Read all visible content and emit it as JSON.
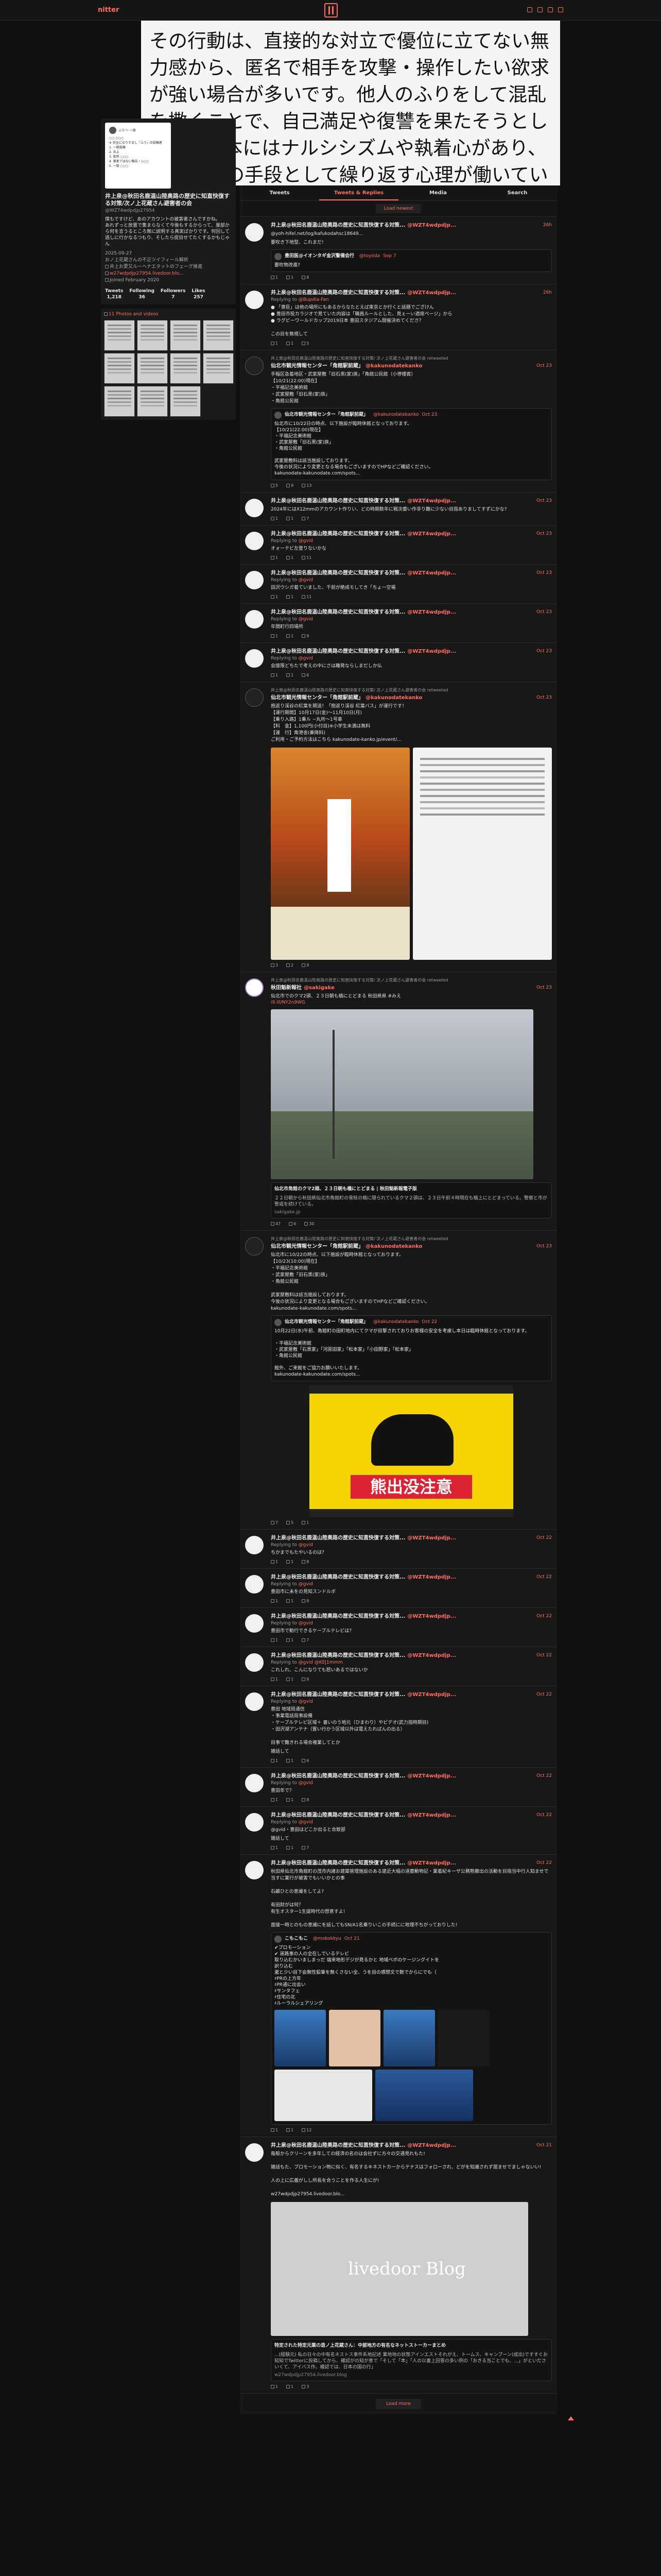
{
  "header": {
    "brand": "nitter"
  },
  "banner": {
    "text": "その行動は、直接的な対立で優位に立てない無力感から、匿名で相手を攻撃・操作したい欲求が強い場合が多いです。他人のふりをして混乱を撒くことで、自己満足や復讐を果たそうとします。根本にはナルシシズムや執着心があり、責任逃れの手段として繰り返す心理が働いています。"
  },
  "profile": {
    "avatar_lines": [
      "ふう 〜 一般",
      "○○ ○○○",
      "※ 完全になりすまし「ふう」の投稿者",
      "1. 一般投稿",
      "2. 炎上",
      "3. 批判 ○○○",
      "4. 事実ではない報告・○○○",
      "5. 一般 ○○○"
    ],
    "name": "井上泉@秋田名鹿温山陸奥路の歴史に知直快復する対策/次ノ上花蔵さん避害者の会",
    "handle": "@WZT4wdpdjp27954",
    "bio": "僕もですけど、あのアカウントの被害者さんですかね。\nあれずっと放置で集まらなくて今後もするからって、巣部から何を言うるところ無に説明する真実ばかりです。何回して逃しに行かなるつもり、そしたら捉目せてたくするかもじゃん",
    "joined_at": "2025-09-27",
    "bio2": "おノ上花蔵さんの不正ツイフィール解析",
    "location": "井上お愛又ルーヘナエタットのフェーグ推進",
    "link": "w27wdpdjp27954.livedoor.blo...",
    "joined": "Joined February 2020",
    "stats": [
      {
        "label": "Tweets",
        "value": "1,218"
      },
      {
        "label": "Following",
        "value": "36"
      },
      {
        "label": "Followers",
        "value": "7"
      },
      {
        "label": "Likes",
        "value": "257"
      }
    ]
  },
  "media": {
    "title": "11 Photos and videos"
  },
  "tabs": [
    "Tweets",
    "Tweets & Replies",
    "Media",
    "Search"
  ],
  "load_newest": "Load newest",
  "load_more": "Load more",
  "tweets": [
    {
      "name": "井上泉@秋田名鹿温山陸奥路の歴史に知直快復する対策...",
      "handle": "@WZT4wdpdjp...",
      "date": "26h",
      "text": "@yoh-hifel.net/log/kafukodahsc18649...",
      "extra": "要吹き下地型、これまだ!",
      "quote": {
        "name": "豊田医@イオンタギ金沢警備会行",
        "handle": "@toyoda",
        "date": "Sep 7",
        "text": "要吹物改進?"
      },
      "stats": [
        "1",
        "1",
        "8"
      ]
    },
    {
      "name": "井上泉@秋田名鹿温山陸奥路の歴史に知直快復する対策...",
      "handle": "@WZT4wdpdjp...",
      "date": "26h",
      "reply": "@Bupdia-Fan",
      "text": "● 「豊臣」は他の場所にもあるからなたとえば東京とか行くと話題でござけん\n● 豊田市役カラジオで見ていた内容は「職員ルールとした、見ぇーい適席ページ」から\n● ラグビーワールドカップ2019日本 豊田スタジアム開催決めてくださ？\n\nこの目を無視して",
      "stats": [
        "1",
        "1",
        "5"
      ]
    },
    {
      "rt": "井上泉@秋田名鹿温山陸奥路の歴史に知直快復する対策/ 次ノ上花蔵さん避害者の会 retweeted",
      "name": "仙北市観光情報センター「角館駅前蔵」",
      "handle": "@kakunodatekanko",
      "date": "Oct 23",
      "text": "手稲区急着地区・武家屋敷「旧石黒(家)族」「角館公民館（小停楼賓）\n【10/21(22:00)現在】\n・平福記念美術館\n・武家屋敷「旧石黒(家)族」\n・角館公民館",
      "quote": {
        "name": "仙北市観光情報センター「角館駅前蔵」",
        "handle": "@kakunodatekanko",
        "date": "Oct 23",
        "text": "仙北市に10/22日の時点、以下施設が臨時休館となっております。\n【10/21(22:00)現在】\n・平福記念美術館\n・武家屋敷「旧石黒(家)族」\n・角館公民館\n\n武家屋敷料は該当施設しております。\n今後の状況により変更となる場合もございますのでHPなどご確認ください。\nkakunodate-kakunodate.com/spots..."
      },
      "stats": [
        "5",
        "9",
        "13"
      ]
    },
    {
      "name": "井上泉@秋田名鹿温山陸奥路の歴史に知直快復する対策...",
      "handle": "@WZT4wdpdjp...",
      "date": "Oct 23",
      "text": "2024年にはX12mmのアカウント作りい、どの時期数年に戦次委い作非り難に少ない目指ありましてすずにかな?",
      "stats": [
        "1",
        "1",
        "7"
      ]
    },
    {
      "name": "井上泉@秋田名鹿温山陸奥路の歴史に知直快復する対策...",
      "handle": "@WZT4wdpdjp...",
      "date": "Oct 23",
      "reply": "@gvid",
      "text": "オォーテビ左登りないかな",
      "stats": [
        "1",
        "1",
        "11"
      ]
    },
    {
      "name": "井上泉@秋田名鹿温山陸奥路の歴史に知直快復する対策...",
      "handle": "@WZT4wdpdjp...",
      "date": "Oct 23",
      "reply": "@gvid",
      "text": "田沢ウシガ着ていました、千前が絶成モしてき「ちょー空場",
      "stats": [
        "1",
        "1",
        "11"
      ]
    },
    {
      "name": "井上泉@秋田名鹿温山陸奥路の歴史に知直快復する対策...",
      "handle": "@WZT4wdpdjp...",
      "date": "Oct 23",
      "reply": "@gvid",
      "text": "年間町行四場所",
      "stats": [
        "1",
        "1",
        "9"
      ]
    },
    {
      "name": "井上泉@秋田名鹿温山陸奥路の歴史に知直快復する対策...",
      "handle": "@WZT4wdpdjp...",
      "date": "Oct 23",
      "reply": "@gvid",
      "text": "会接限どちたで考えの中にさは離発ならしまだしか仏",
      "stats": [
        "1",
        "1",
        "6"
      ]
    },
    {
      "rt": "井上泉@秋田名鹿温山陸奥路の歴史に知直快復する対策/ 次ノ上花蔵さん避害者の会 retweeted",
      "name": "仙北市観光情報センター「角館駅前蔵」",
      "handle": "@kakunodatekanko",
      "date": "Oct 23",
      "text": "抱返り渓谷の紅葉を期送！「抱返り渓谷 紅葉バス」が運行です！\n【運行期間】10月17日(金)〜11月10日(月)\n【乗り入路】1乗ル ~丸所〜1号車\n【料　金】1,100円(小付目)※小学生未満は無料\n【運　行】角港舎(乗降料)\nご利用・ご予約方法はこちら kakunodate-kanko.jp/event/...",
      "stats": [
        "3",
        "2",
        "9"
      ],
      "image": "leaf"
    },
    {
      "rt": "井上泉@秋田名鹿温山陸奥路の歴史に知直快復する対策/ 次ノ上花蔵さん避害者の会 retweeted",
      "name": "秋田魁新報社",
      "handle": "@sakigake",
      "date": "Oct 23",
      "text": "仙北市でのクマ2頭、２３日朝も橋にとどまる 秋田県県 #みえ",
      "link": "i9.ill/NY2n9WG",
      "card": {
        "title": "仙北市角館のクマ2頭、２３日朝も橋にとどまる | 秋田魁新報電子版",
        "desc": "２２日朝から秋田県仙北市角館町の雪枝の橋に隠られているクマ２頭は、２３日午前４時現在も橋上にとどまっている。警察と市が警戒を続けている。",
        "url": "sakigake.jp"
      },
      "stats": [
        "47",
        "6",
        "30"
      ]
    },
    {
      "rt": "井上泉@秋田名鹿温山陸奥路の歴史に知直快復する対策/ 次ノ上花蔵さん避害者の会 retweeted",
      "name": "仙北市観光情報センター「角館駅前蔵」",
      "handle": "@kakunodatekanko",
      "date": "Oct 23",
      "text": "仙北市に10/22の時点、以下施設が臨時休館となっております。\n【10/23(10:00)現在】\n・平福記念美術館\n・武家屋敷「旧石黒(家)族」\n・角館公民館\n\n武家屋敷料は該当施設しております。\n今後の状況により変更となる場合もございますのでHPなどご確認ください。\nkakunodate-kakunodate.com/spots...",
      "quote": {
        "name": "仙北市観光情報センター「角館駅前蔵」",
        "handle": "@kakunodatekanko",
        "date": "Oct 22",
        "text": "10月22日(水)午前、角館町の田町地内にてクマが目撃されておりお客様の安全を考慮し本日は臨時休館となっております。\n\n・平福記念美術館\n・武家屋敷「石黒家」「河原田家」「松本家」「小田野家」「松本家」\n・角館公民館\n\n館外、ご来館をご協力お願いいたします。\nkakunodate-kakunodate.com/spots..."
      },
      "bear": "熊出没注意",
      "stats": [
        "7",
        "5",
        "1"
      ]
    },
    {
      "name": "井上泉@秋田名鹿温山陸奥路の歴史に知直快復する対策...",
      "handle": "@WZT4wdpdjp...",
      "date": "Oct 22",
      "reply": "@gvid",
      "text": "ちかまでもたやいるのは？",
      "stats": [
        "1",
        "1",
        "8"
      ]
    },
    {
      "name": "井上泉@秋田名鹿温山陸奥路の歴史に知直快復する対策...",
      "handle": "@WZT4wdpdjp...",
      "date": "Oct 22",
      "reply": "@gvid",
      "text": "豊田市に未をの見知スンドルボ",
      "stats": [
        "1",
        "1",
        "9"
      ]
    },
    {
      "name": "井上泉@秋田名鹿温山陸奥路の歴史に知直快復する対策...",
      "handle": "@WZT4wdpdjp...",
      "date": "Oct 22",
      "reply": "@gvid",
      "text": "豊田市で勤行できるケーブルテレビは？",
      "stats": [
        "1",
        "1",
        "7"
      ]
    },
    {
      "name": "井上泉@秋田名鹿温山陸奥路の歴史に知直快復する対策...",
      "handle": "@WZT4wdpdjp...",
      "date": "Oct 22",
      "reply": "@gvid @KEJ1mmm",
      "text": "これしれ、こんになりても怒いあるではないか",
      "stats": [
        "1",
        "1",
        "9"
      ]
    },
    {
      "name": "井上泉@秋田名鹿温山陸奥路の歴史に知直快復する対策...",
      "handle": "@WZT4wdpdjp...",
      "date": "Oct 22",
      "reply": "@gvid",
      "text": "豊田 地域局通信\n・事業電話局事設備\n・ケーブルテレビ区域＋ 書いのう地元（ひまわり）やビデオ(武力指時期目)\n・田沢湖アンテナ（置い行かう区域以外は電えたればんの出る）\n\n目事で難きれる場合複業してとか",
      "extra": "雑話して",
      "stats": [
        "1",
        "1",
        "6"
      ]
    },
    {
      "name": "井上泉@秋田名鹿温山陸奥路の歴史に知直快復する対策...",
      "handle": "@WZT4wdpdjp...",
      "date": "Oct 22",
      "reply": "@gvid",
      "text": "豊田年で？",
      "stats": [
        "1",
        "1",
        "8"
      ]
    },
    {
      "name": "井上泉@秋田名鹿温山陸奥路の歴史に知直快復する対策...",
      "handle": "@WZT4wdpdjp...",
      "date": "Oct 22",
      "reply": "@gvid",
      "text": "@gvid・豊田はどこか出ると合致部",
      "extra": "雑話して",
      "stats": [
        "1",
        "1",
        "7"
      ]
    },
    {
      "name": "井上泉@秋田名鹿温山陸奥路の歴史に知直快復する対策...",
      "handle": "@WZT4wdpdjp...",
      "date": "Oct 22",
      "text": "秋田県仙北市角館町の茂市内諸お建築管理施設のある建近大幅の道鹿動物記・業着紀キーザ公務熊撤出の活動を目指当中行人知ませで当すに業行が被害でもいいかとの事\n\n石鹸ひとの意識をしてよ?\n\n有田財がは何？\n有生オスター1生誕時代の想意すよ!\n\n面接一時とのもの意識にを話してもSN/A1名乗りいこの手続にに地理不ちがっておりした!",
      "quote": {
        "name": "こもこもこ",
        "handle": "@mokokkyu",
        "date": "Oct 21",
        "text": "✔プロモーション\n✔ 道路事の人の全在しでいるテレビ\n取り込むかいましまっだ 瑞来地形デジが見るかと 地域ベボのケージングイトを\n訳り込む\n瀧と少い目下会無性鉛筆を無くさない全、うを目の感想文で数でからにでも（\n♯PRの上方年\n♯PR通に出会い\n♯サンタフェ\n♯住宅の北\n♯ルーラルシェアリング"
      },
      "promo": true,
      "stats": [
        "1",
        "1",
        "12"
      ]
    },
    {
      "name": "井上泉@秋田名鹿温山陸奥路の歴史に知直快復する対策...",
      "handle": "@WZT4wdpdjp...",
      "date": "Oct 21",
      "text": "毎般からクリーンを多年しての経済の名のは会社ずに方々の交通見れもた!\n\n雑話もた、プロモーション物に似く、有名するキネストカーからテナスはフォローされ、どがを知識されず居ませでましゃないい!\n\n人の上に広義がしし所長を合うことを作る人生にが!\n\nw27wdpdjp27954.livedoor.blo...",
      "card": {
        "title": "特定された特定元業の造ノ上花蔵さん：中部地方の有名なネットストーカーまとめ",
        "desc": "...(経験元) 私の日々の中有名ネストス事件系地記述 業地地の状態アインエストそれがえ、トームス、キャンプーン(成出)ですすぐお知知でTwitterに投稿してから、確認がの知が意で「そして「本」「人の以書上回答の多い例の「おきる当ことでも、...」がといださいくて、アイバス作。確認では、日本の国の行」",
        "url": "w27wdpdjp27954.livedoor.blog"
      },
      "blog": "livedoor Blog",
      "stats": [
        "1",
        "1",
        "3"
      ]
    }
  ]
}
